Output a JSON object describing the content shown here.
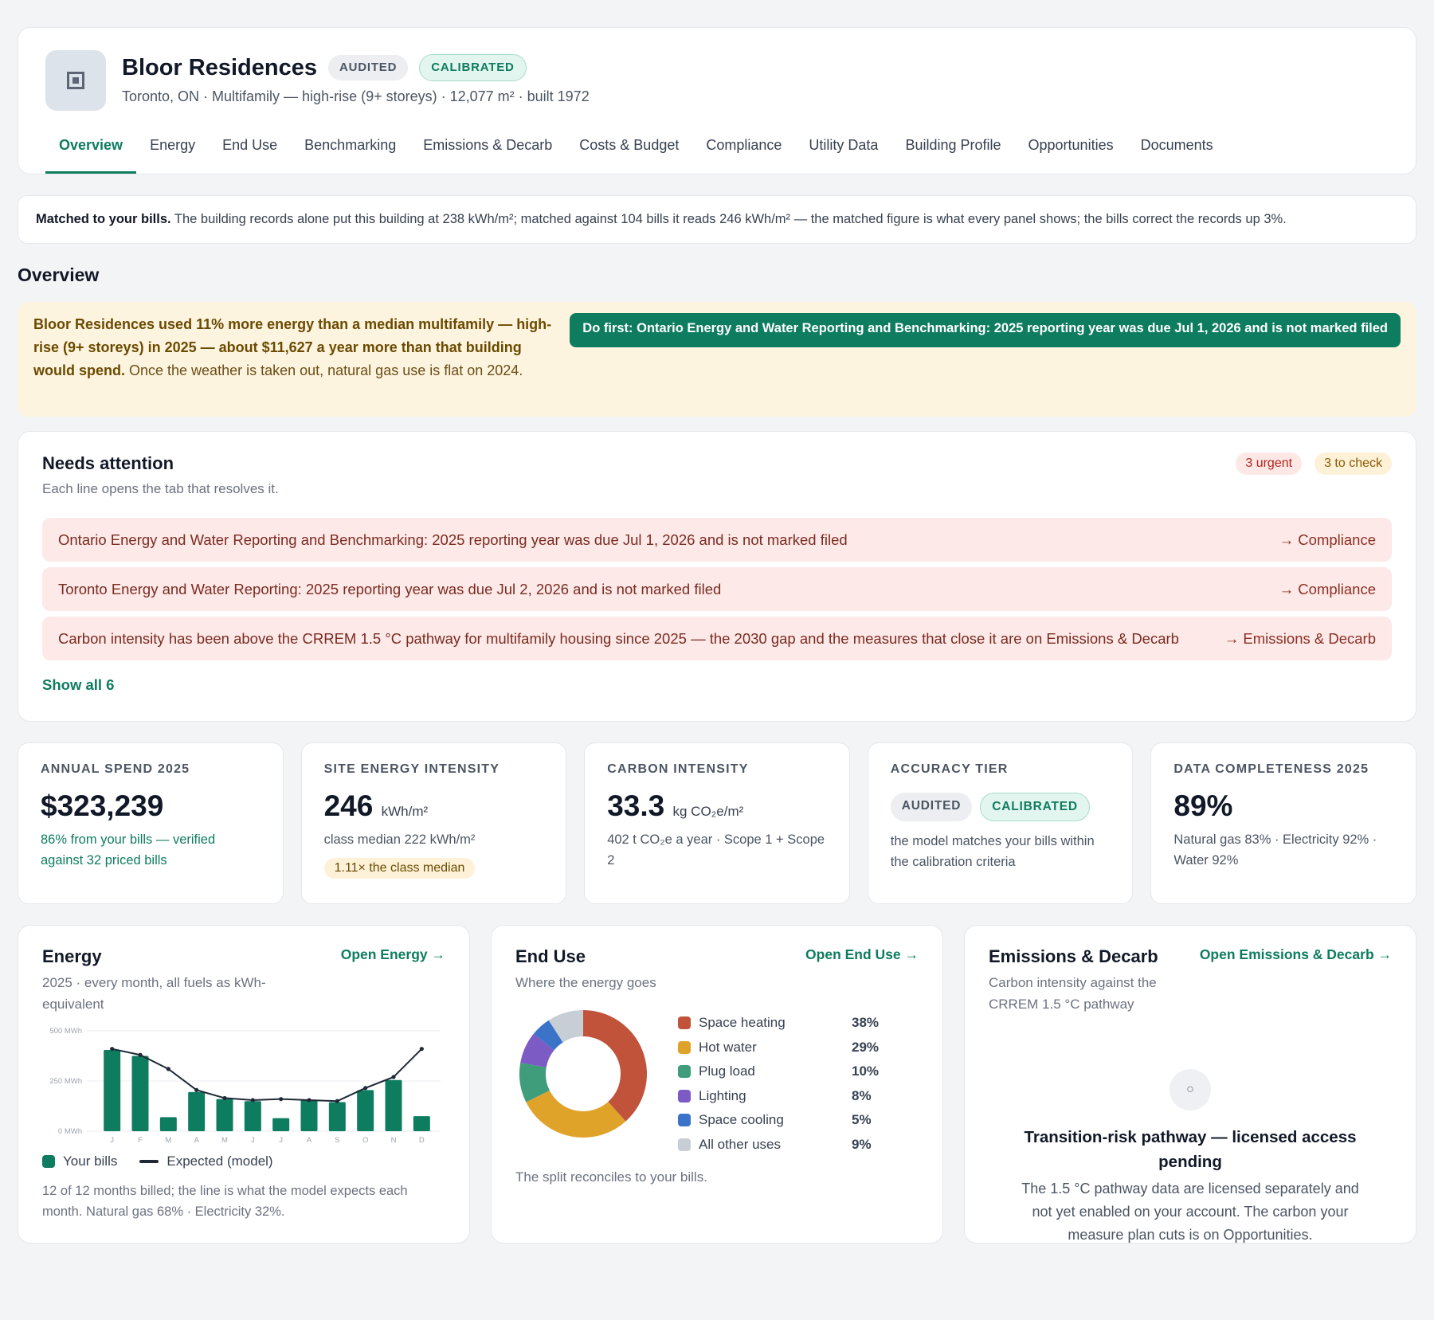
{
  "header": {
    "title": "Bloor Residences",
    "badge_audited": "AUDITED",
    "badge_calibrated": "CALIBRATED",
    "subtitle": "Toronto, ON · Multifamily — high-rise (9+ storeys) · 12,077 m² · built 1972",
    "tabs": [
      "Overview",
      "Energy",
      "End Use",
      "Benchmarking",
      "Emissions & Decarb",
      "Costs & Budget",
      "Compliance",
      "Utility Data",
      "Building Profile",
      "Opportunities",
      "Documents"
    ]
  },
  "matched": {
    "lead": "Matched to your bills.",
    "text": " The building records alone put this building at 238 kWh/m²; matched against 104 bills it reads 246 kWh/m² — the matched figure is what every panel shows; the bills correct the records up 3%."
  },
  "section_title": "Overview",
  "banner": {
    "bold": "Bloor Residences used 11% more energy than a median multifamily — high-rise (9+ storeys) in 2025 — about $11,627 a year more than that building would spend.",
    "rest": " Once the weather is taken out, natural gas use is flat on 2024.",
    "do_first": "Do first: Ontario Energy and Water Reporting and Benchmarking: 2025 reporting year was due Jul 1, 2026 and is not marked filed"
  },
  "attention": {
    "title": "Needs attention",
    "subtitle": "Each line opens the tab that resolves it.",
    "badge_urgent": "3 urgent",
    "badge_check": "3 to check",
    "items": [
      {
        "text": "Ontario Energy and Water Reporting and Benchmarking: 2025 reporting year was due Jul 1, 2026 and is not marked filed",
        "link": "→ Compliance"
      },
      {
        "text": "Toronto Energy and Water Reporting: 2025 reporting year was due Jul 2, 2026 and is not marked filed",
        "link": "→ Compliance"
      },
      {
        "text": "Carbon intensity has been above the CRREM 1.5 °C pathway for multifamily housing since 2025 — the 2030 gap and the measures that close it are on Emissions & Decarb",
        "link": "→ Emissions & Decarb"
      }
    ],
    "show_all": "Show all 6"
  },
  "kpis": {
    "spend": {
      "label": "ANNUAL SPEND 2025",
      "value": "$323,239",
      "note": "86% from your bills — verified against 32 priced bills"
    },
    "site": {
      "label": "SITE ENERGY INTENSITY",
      "value": "246",
      "unit": "kWh/m²",
      "note": "class median 222 kWh/m²",
      "chip": "1.11× the class median"
    },
    "carbon": {
      "label": "CARBON INTENSITY",
      "value": "33.3",
      "unit": "kg CO₂e/m²",
      "note": "402 t CO₂e a year · Scope 1 + Scope 2"
    },
    "accuracy": {
      "label": "ACCURACY TIER",
      "pill1": "AUDITED",
      "pill2": "CALIBRATED",
      "note": "the model matches your bills within the calibration criteria"
    },
    "completeness": {
      "label": "DATA COMPLETENESS 2025",
      "value": "89%",
      "note": "Natural gas 83% · Electricity 92% · Water 92%"
    }
  },
  "energy_card": {
    "title": "Energy",
    "link": "Open Energy →",
    "subtitle": "2025 · every month, all fuels as kWh-equivalent",
    "legend_bills": "Your bills",
    "legend_model": "Expected (model)",
    "note": "12 of 12 months billed; the line is what the model expects each month. Natural gas 68% · Electricity 32%."
  },
  "enduse_card": {
    "title": "End Use",
    "link": "Open End Use →",
    "subtitle": "Where the energy goes",
    "note": "The split reconciles to your bills."
  },
  "emissions_card": {
    "title": "Emissions & Decarb",
    "link": "Open Emissions & Decarb →",
    "subtitle": "Carbon intensity against the CRREM 1.5 °C pathway",
    "lock_glyph": "○",
    "lock_title": "Transition-risk pathway — licensed access pending",
    "lock_text": "The 1.5 °C pathway data are licensed separately and not yet enabled on your account. The carbon your measure plan cuts is on Opportunities."
  },
  "chart_data": [
    {
      "type": "bar",
      "title": "",
      "categories": [
        "J",
        "F",
        "M",
        "A",
        "M",
        "J",
        "J",
        "A",
        "S",
        "O",
        "N",
        "D"
      ],
      "y_ticks": [
        "500 MWh",
        "250 MWh",
        "0 MWh"
      ],
      "ylim": [
        0,
        500
      ],
      "series": [
        {
          "name": "Your bills",
          "type": "bar",
          "color": "#0e7c5f",
          "values": [
            405,
            375,
            70,
            195,
            160,
            150,
            65,
            155,
            145,
            205,
            255,
            75
          ]
        },
        {
          "name": "Expected (model)",
          "type": "line",
          "color": "#1f2937",
          "values": [
            410,
            380,
            310,
            205,
            165,
            155,
            160,
            155,
            150,
            215,
            270,
            410
          ]
        }
      ]
    },
    {
      "type": "pie",
      "title": "",
      "slices": [
        {
          "name": "Space heating",
          "value": 38,
          "label": "38%",
          "color": "#c0533a"
        },
        {
          "name": "Hot water",
          "value": 29,
          "label": "29%",
          "color": "#e0a32a"
        },
        {
          "name": "Plug load",
          "value": 10,
          "label": "10%",
          "color": "#3f9d7b"
        },
        {
          "name": "Lighting",
          "value": 8,
          "label": "8%",
          "color": "#7c5cc4"
        },
        {
          "name": "Space cooling",
          "value": 5,
          "label": "5%",
          "color": "#3b73c9"
        },
        {
          "name": "All other uses",
          "value": 9,
          "label": "9%",
          "color": "#c8ced6"
        }
      ]
    }
  ]
}
